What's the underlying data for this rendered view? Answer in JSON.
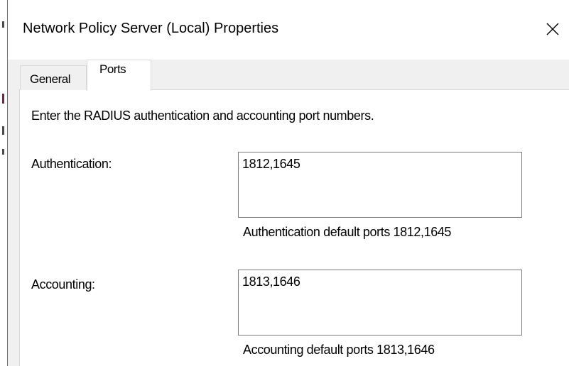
{
  "dialog": {
    "title": "Network Policy Server (Local) Properties",
    "close_icon": "close-icon"
  },
  "tabs": [
    {
      "label": "General",
      "selected": false
    },
    {
      "label": "Ports",
      "selected": true
    }
  ],
  "ports_page": {
    "instructions": "Enter the RADIUS authentication and accounting port numbers.",
    "authentication": {
      "label": "Authentication:",
      "value": "1812,1645",
      "hint": "Authentication default ports 1812,1645"
    },
    "accounting": {
      "label": "Accounting:",
      "value": "1813,1646",
      "hint": "Accounting default ports 1813,1646"
    }
  }
}
